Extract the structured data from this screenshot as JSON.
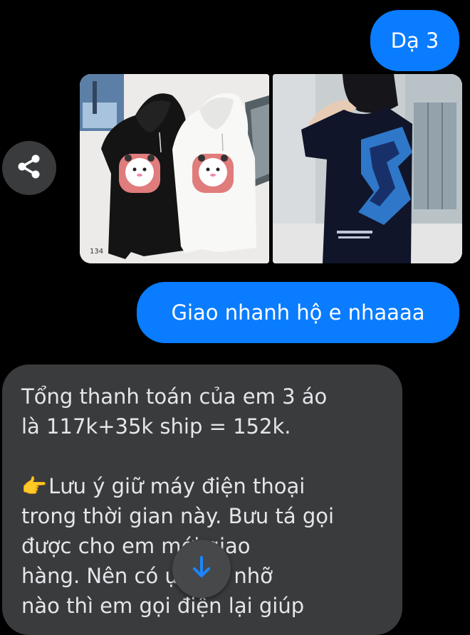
{
  "messages": {
    "out_1": "Dạ 3",
    "out_2": "Giao nhanh hộ e nhaaaa",
    "in_1": {
      "line1": "Tổng thanh toán của em 3 áo",
      "line2": "là 117k+35k ship = 152k.",
      "line3": "Lưu ý giữ máy điện thoại",
      "line4": "trong thời gian này. Bưu tá gọi",
      "line5": "được cho em mới giao",
      "line6": "hàng. Nên có ực gọi nhỡ",
      "line7": "nào thì em gọi điện lại giúp"
    }
  },
  "photos": {
    "photo1_caption": "134"
  },
  "icons": {
    "share": "share-icon",
    "scroll_down": "arrow-down-icon",
    "pointing_hand": "pointing-hand-emoji"
  },
  "colors": {
    "background": "#000000",
    "outgoing_bubble": "#0a7cff",
    "incoming_bubble": "#3a3b3c",
    "accent_arrow": "#0a7cff"
  }
}
